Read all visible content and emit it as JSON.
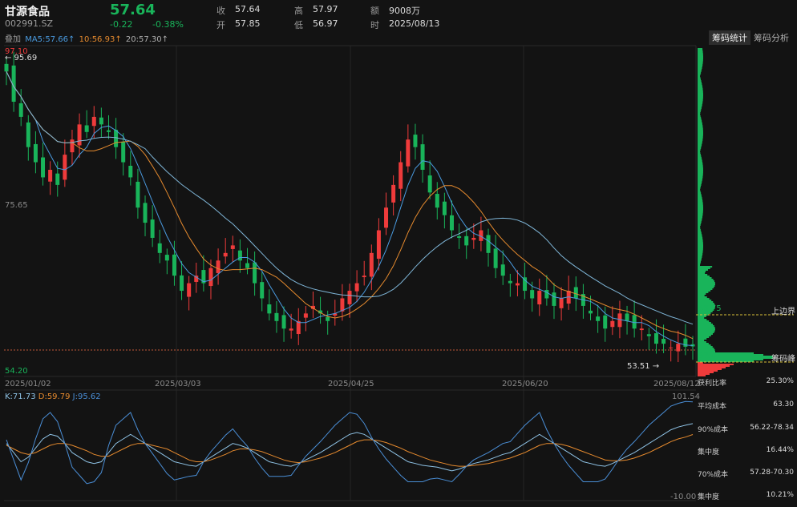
{
  "header": {
    "name": "甘源食品",
    "code": "002991.SZ",
    "price": "57.64",
    "change": "-0.22",
    "change_pct": "-0.38%",
    "quotes": [
      {
        "label": "收",
        "value": "57.64"
      },
      {
        "label": "高",
        "value": "57.97"
      },
      {
        "label": "额",
        "value": "9008万"
      },
      {
        "label": "开",
        "value": "57.85"
      },
      {
        "label": "低",
        "value": "56.97"
      },
      {
        "label": "时",
        "value": "2025/08/13"
      }
    ]
  },
  "ma": {
    "overlay_label": "叠加",
    "ma5": "MA5:57.66↑",
    "ma10": "10:56.93↑",
    "ma20": "20:57.30↑"
  },
  "tabs": [
    "筹码统计",
    "筹码分析"
  ],
  "axis": {
    "top_price": "97.10",
    "mid_price": "75.65",
    "low_price": "54.20",
    "marker_high": "← 95.69",
    "marker_low": "53.51 →",
    "dates": [
      "2025/01/02",
      "2025/03/03",
      "2025/04/25",
      "2025/06/20",
      "2025/08/12"
    ]
  },
  "chips": {
    "upper_value": "63.75",
    "upper_label": "上边界",
    "peak_value": "57.41",
    "peak_label": "筹码峰",
    "stats": [
      {
        "label": "获利比率",
        "value": "25.30%"
      },
      {
        "label": "平均成本",
        "value": "63.30"
      },
      {
        "label": "90%成本",
        "value": "56.22-78.34"
      },
      {
        "label": "集中度",
        "value": "16.44%"
      },
      {
        "label": "70%成本",
        "value": "57.28-70.30"
      },
      {
        "label": "集中度",
        "value": "10.21%"
      }
    ]
  },
  "kdj": {
    "k": "K:71.73",
    "d": "D:59.79",
    "j": "J:95.62",
    "top": "101.54",
    "bottom": "-10.00"
  },
  "colors": {
    "up": "#ef3b3b",
    "down": "#19b45a",
    "ma5": "#4a9be0",
    "ma10": "#e58a2e",
    "ma20": "#7fb6d8",
    "kline": "#8fc3e6",
    "dline": "#e58a2e",
    "jline": "#4a8ed6"
  },
  "chart_data": {
    "type": "candlestick",
    "ylim": [
      54.2,
      97.1
    ],
    "closes": [
      94,
      90,
      88,
      84,
      82,
      80,
      81,
      79,
      83,
      85,
      87,
      86,
      88,
      87,
      86,
      84,
      82,
      80,
      76,
      74,
      72,
      70,
      69,
      67,
      65,
      66,
      67,
      66,
      68,
      69,
      70,
      71,
      69,
      68,
      66,
      64,
      62,
      61,
      60,
      60,
      61,
      62,
      63,
      62,
      61,
      62,
      64,
      65,
      66,
      67,
      70,
      73,
      76,
      79,
      82,
      85,
      84,
      81,
      78,
      76,
      75,
      73,
      72,
      71,
      72,
      73,
      70,
      68,
      67,
      66,
      66,
      65,
      64,
      65,
      64,
      63,
      64,
      65,
      64,
      63,
      62,
      61,
      60,
      61,
      62,
      61,
      60,
      60,
      59,
      58,
      58,
      57.5,
      58,
      57.6,
      57.64
    ],
    "kdj_k": [
      50,
      40,
      30,
      35,
      45,
      55,
      60,
      58,
      50,
      40,
      35,
      30,
      28,
      30,
      40,
      50,
      55,
      60,
      55,
      50,
      45,
      40,
      35,
      30,
      28,
      26,
      25,
      30,
      35,
      40,
      45,
      50,
      48,
      45,
      40,
      35,
      30,
      28,
      26,
      25,
      28,
      32,
      36,
      40,
      45,
      50,
      55,
      60,
      62,
      60,
      55,
      50,
      45,
      40,
      35,
      30,
      28,
      26,
      25,
      24,
      22,
      20,
      22,
      25,
      28,
      30,
      32,
      35,
      38,
      40,
      45,
      50,
      55,
      60,
      55,
      50,
      45,
      40,
      35,
      30,
      28,
      26,
      25,
      28,
      32,
      36,
      40,
      45,
      50,
      55,
      60,
      65,
      68,
      70,
      71.73
    ],
    "kdj_d": [
      48,
      44,
      40,
      38,
      40,
      44,
      48,
      50,
      50,
      48,
      45,
      42,
      38,
      36,
      36,
      40,
      44,
      48,
      50,
      50,
      48,
      46,
      44,
      40,
      36,
      32,
      30,
      30,
      32,
      35,
      38,
      42,
      44,
      44,
      43,
      41,
      38,
      35,
      32,
      30,
      29,
      30,
      32,
      34,
      37,
      40,
      44,
      48,
      52,
      54,
      54,
      53,
      51,
      48,
      45,
      41,
      38,
      35,
      32,
      30,
      28,
      26,
      25,
      25,
      26,
      27,
      28,
      30,
      32,
      34,
      37,
      40,
      44,
      48,
      50,
      50,
      49,
      47,
      44,
      41,
      38,
      35,
      32,
      31,
      31,
      32,
      34,
      37,
      40,
      44,
      48,
      52,
      55,
      57,
      59.79
    ],
    "kdj_j": [
      54,
      32,
      10,
      29,
      55,
      77,
      84,
      74,
      50,
      24,
      15,
      6,
      8,
      18,
      48,
      70,
      77,
      84,
      65,
      50,
      39,
      28,
      17,
      10,
      12,
      14,
      15,
      30,
      41,
      50,
      59,
      66,
      56,
      47,
      34,
      23,
      14,
      14,
      14,
      15,
      26,
      36,
      44,
      52,
      61,
      70,
      77,
      84,
      82,
      72,
      57,
      44,
      33,
      24,
      15,
      8,
      8,
      8,
      11,
      12,
      10,
      8,
      16,
      25,
      32,
      36,
      40,
      45,
      50,
      52,
      61,
      70,
      77,
      84,
      65,
      50,
      37,
      26,
      17,
      8,
      8,
      8,
      11,
      22,
      34,
      44,
      52,
      61,
      70,
      77,
      84,
      91,
      94,
      96,
      95.62
    ]
  }
}
